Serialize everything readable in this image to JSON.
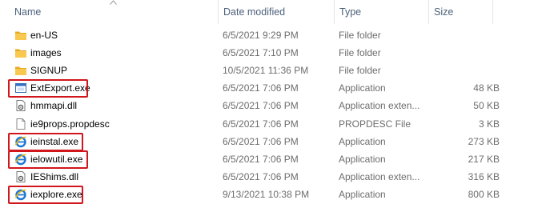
{
  "columns": {
    "name": "Name",
    "date": "Date modified",
    "type": "Type",
    "size": "Size"
  },
  "files": [
    {
      "name": "en-US",
      "date": "6/5/2021 9:29 PM",
      "type": "File folder",
      "size": "",
      "icon": "folder-icon",
      "highlighted": false
    },
    {
      "name": "images",
      "date": "6/5/2021 7:10 PM",
      "type": "File folder",
      "size": "",
      "icon": "folder-icon",
      "highlighted": false
    },
    {
      "name": "SIGNUP",
      "date": "10/5/2021 11:36 PM",
      "type": "File folder",
      "size": "",
      "icon": "folder-icon",
      "highlighted": false
    },
    {
      "name": "ExtExport.exe",
      "date": "6/5/2021 7:06 PM",
      "type": "Application",
      "size": "48 KB",
      "icon": "application-window-icon",
      "highlighted": true
    },
    {
      "name": "hmmapi.dll",
      "date": "6/5/2021 7:06 PM",
      "type": "Application exten...",
      "size": "50 KB",
      "icon": "dll-gear-icon",
      "highlighted": false
    },
    {
      "name": "ie9props.propdesc",
      "date": "6/5/2021 7:06 PM",
      "type": "PROPDESC File",
      "size": "3 KB",
      "icon": "blank-file-icon",
      "highlighted": false
    },
    {
      "name": "ieinstal.exe",
      "date": "6/5/2021 7:06 PM",
      "type": "Application",
      "size": "273 KB",
      "icon": "internet-explorer-icon",
      "highlighted": true
    },
    {
      "name": "ielowutil.exe",
      "date": "6/5/2021 7:06 PM",
      "type": "Application",
      "size": "217 KB",
      "icon": "internet-explorer-icon",
      "highlighted": true
    },
    {
      "name": "IEShims.dll",
      "date": "6/5/2021 7:06 PM",
      "type": "Application exten...",
      "size": "316 KB",
      "icon": "dll-gear-icon",
      "highlighted": false
    },
    {
      "name": "iexplore.exe",
      "date": "9/13/2021 10:38 PM",
      "type": "Application",
      "size": "800 KB",
      "icon": "internet-explorer-icon",
      "highlighted": true
    }
  ],
  "colors": {
    "highlight_border": "#d1161c",
    "header_text": "#4c607a",
    "folder": "#f8c84f",
    "ie_blue": "#1e78d6"
  }
}
